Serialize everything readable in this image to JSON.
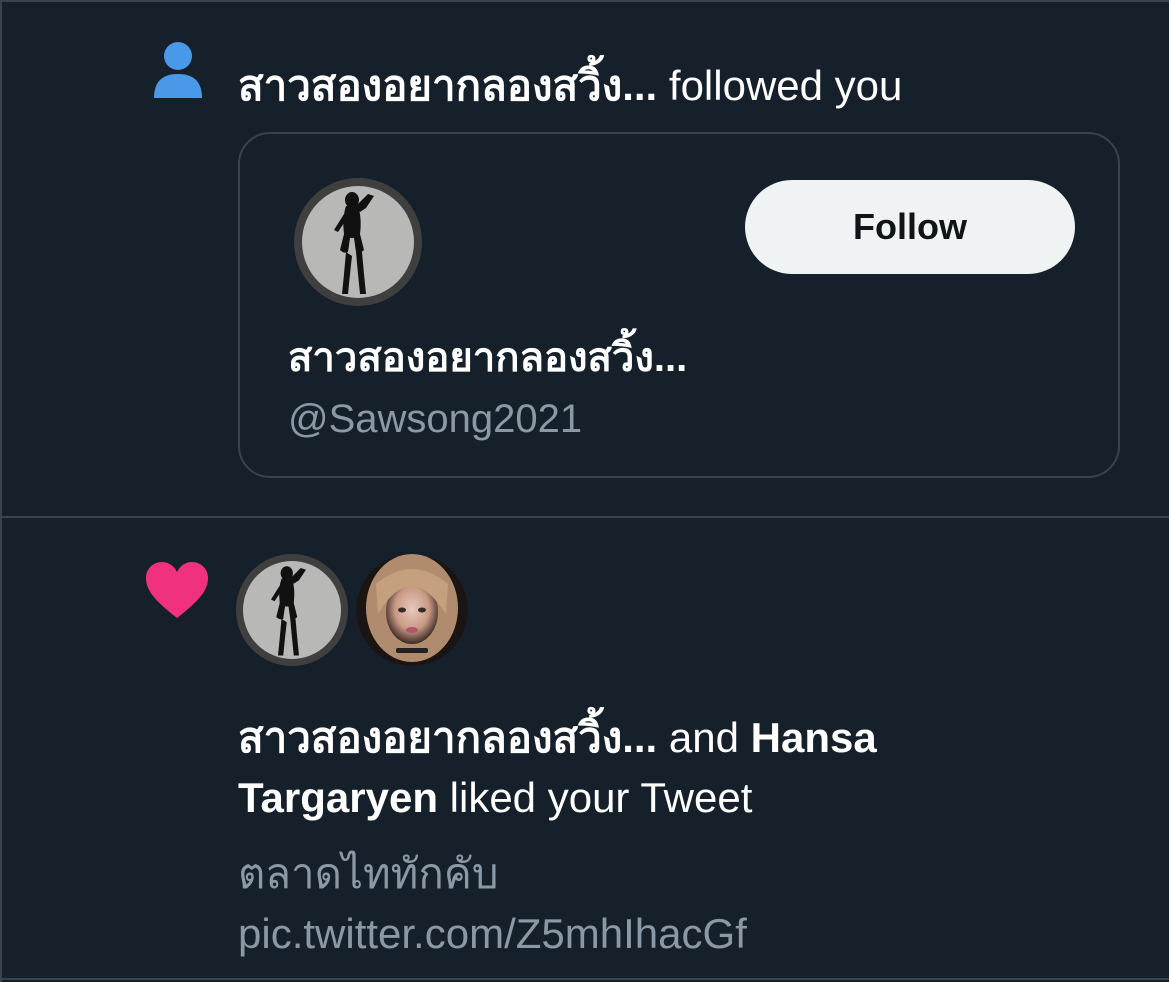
{
  "follow_notification": {
    "icon": "person-icon",
    "actor_name": "สาวสองอยากลองสวิ้ง...",
    "action_text": "followed you",
    "card": {
      "display_name": "สาวสองอยากลองสวิ้ง...",
      "handle": "@Sawsong2021",
      "follow_label": "Follow"
    }
  },
  "like_notification": {
    "icon": "heart-icon",
    "actor_1": "สาวสองอยากลองสวิ้ง...",
    "conjunction": "and",
    "actor_2": "Hansa Targaryen",
    "action_text": "liked your Tweet",
    "tweet_text": "ตลาดไททักคับ pic.twitter.com/Z5mhIhacGf"
  },
  "colors": {
    "background": "#15202b",
    "border": "#38444d",
    "accent_blue": "#4a99e9",
    "like_pink": "#f0317d",
    "secondary_text": "#8b98a5",
    "button_bg": "#eff3f4"
  }
}
